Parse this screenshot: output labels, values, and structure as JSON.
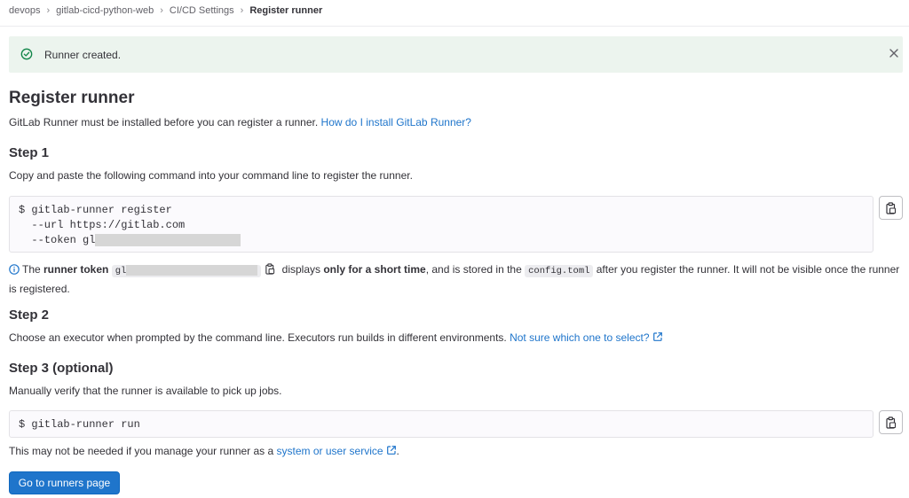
{
  "breadcrumb": {
    "items": [
      "devops",
      "gitlab-cicd-python-web",
      "CI/CD Settings",
      "Register runner"
    ]
  },
  "alert": {
    "message": "Runner created.",
    "color": "#ecf4ee"
  },
  "page": {
    "title": "Register runner",
    "intro_text": "GitLab Runner must be installed before you can register a runner. ",
    "intro_link": "How do I install GitLab Runner?"
  },
  "step1": {
    "title": "Step 1",
    "description": "Copy and paste the following command into your command line to register the runner.",
    "command_lines": [
      "$ gitlab-runner register",
      "  --url https://gitlab.com",
      "  --token gl"
    ]
  },
  "token_note": {
    "prefix": "The ",
    "bold1": "runner token",
    "token_prefix": "gl",
    "middle": " displays ",
    "bold2": "only for a short time",
    "after_bold": ", and is stored in the ",
    "file": "config.toml",
    "suffix": " after you register the runner. It will not be visible once the runner is registered."
  },
  "step2": {
    "title": "Step 2",
    "description": "Choose an executor when prompted by the command line. Executors run builds in different environments. ",
    "link": "Not sure which one to select?"
  },
  "step3": {
    "title": "Step 3 (optional)",
    "description": "Manually verify that the runner is available to pick up jobs.",
    "command": "$ gitlab-runner run",
    "footer_text": "This may not be needed if you manage your runner as a ",
    "footer_link": "system or user service",
    "footer_end": "."
  },
  "actions": {
    "go_button": "Go to runners page"
  },
  "colors": {
    "link": "#1f75cb",
    "primary": "#1f75cb",
    "success_icon": "#108548"
  }
}
